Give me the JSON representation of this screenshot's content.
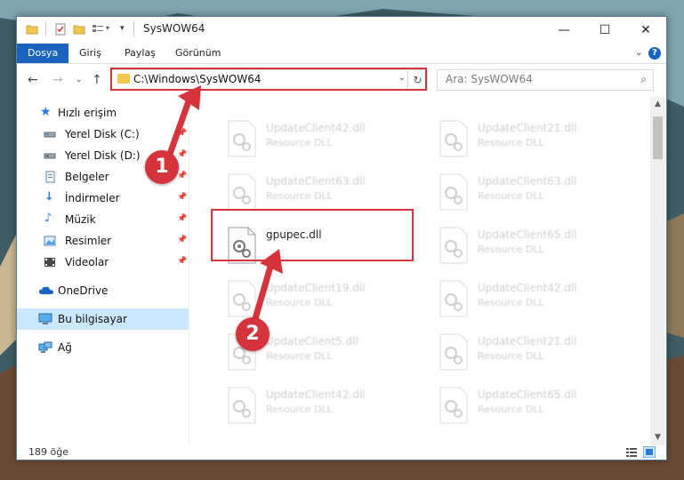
{
  "window": {
    "title": "SysWOW64",
    "controls": {
      "minimize": "—",
      "maximize": "☐",
      "close": "✕"
    }
  },
  "ribbon": {
    "tabs": [
      {
        "label": "Dosya",
        "active": true
      },
      {
        "label": "Giriş",
        "active": false
      },
      {
        "label": "Paylaş",
        "active": false
      },
      {
        "label": "Görünüm",
        "active": false
      }
    ],
    "help": "?",
    "accent": "#1a64c0"
  },
  "address": {
    "path": "C:\\Windows\\SysWOW64",
    "search_placeholder": "Ara: SysWOW64"
  },
  "sidebar": {
    "items": [
      {
        "label": "Hızlı erişim",
        "icon": "star-icon"
      },
      {
        "label": "Yerel Disk (C:)",
        "icon": "drive-icon",
        "pinned": true
      },
      {
        "label": "Yerel Disk (D:)",
        "icon": "drive-icon",
        "pinned": true
      },
      {
        "label": "Belgeler",
        "icon": "documents-icon",
        "pinned": true
      },
      {
        "label": "İndirmeler",
        "icon": "download-icon",
        "pinned": true
      },
      {
        "label": "Müzik",
        "icon": "music-icon",
        "pinned": true
      },
      {
        "label": "Resimler",
        "icon": "pictures-icon",
        "pinned": true
      },
      {
        "label": "Videolar",
        "icon": "videos-icon",
        "pinned": true
      },
      {
        "label": "OneDrive",
        "icon": "cloud-icon"
      },
      {
        "label": "Bu bilgisayar",
        "icon": "computer-icon",
        "selected": true
      },
      {
        "label": "Ağ",
        "icon": "network-icon"
      }
    ]
  },
  "files": {
    "left": [
      {
        "name": "UpdateClient42.dll",
        "type": "Resource DLL"
      },
      {
        "name": "UpdateClient63.dll",
        "type": "Resource DLL"
      },
      {
        "name": "gpupec.dll",
        "type": "",
        "highlight": true
      },
      {
        "name": "UpdateClient19.dll",
        "type": "Resource DLL"
      },
      {
        "name": "UpdateClient5.dll",
        "type": "Resource DLL"
      },
      {
        "name": "UpdateClient42.dll",
        "type": "Resource DLL"
      }
    ],
    "right": [
      {
        "name": "UpdateClient21.dll",
        "type": "Resource DLL"
      },
      {
        "name": "UpdateClient63.dll",
        "type": "Resource DLL"
      },
      {
        "name": "UpdateClient65.dll",
        "type": "Resource DLL"
      },
      {
        "name": "UpdateClient42.dll",
        "type": "Resource DLL"
      },
      {
        "name": "UpdateClient21.dll",
        "type": "Resource DLL"
      },
      {
        "name": "UpdateClient65.dll",
        "type": "Resource DLL"
      }
    ]
  },
  "status": {
    "count": "189 öğe"
  },
  "callouts": [
    {
      "number": "1"
    },
    {
      "number": "2"
    }
  ],
  "colors": {
    "highlight": "#d6343d",
    "selection": "#cce8ff"
  }
}
